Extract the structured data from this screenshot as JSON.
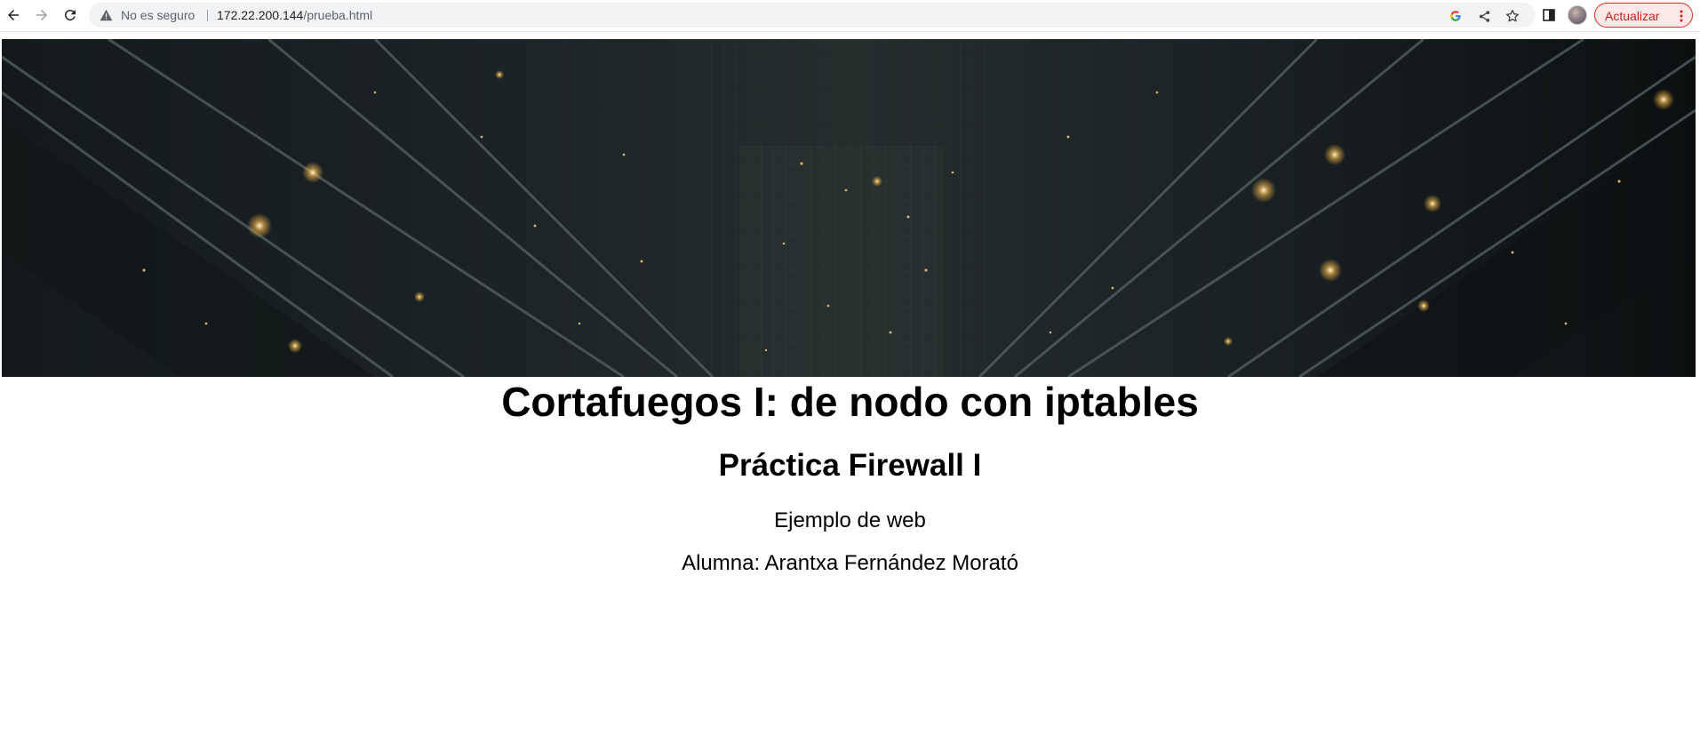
{
  "browser": {
    "security_label": "No es seguro",
    "url_host": "172.22.200.144",
    "url_path": "/prueba.html",
    "update_button_label": "Actualizar",
    "accent_colors": {
      "update": "#d93025",
      "omnibox_bg": "#f1f3f4"
    },
    "icons": [
      "back-arrow-icon",
      "forward-arrow-icon",
      "reload-icon",
      "warning-icon",
      "google-icon",
      "share-icon",
      "star-icon",
      "side-panel-icon",
      "avatar",
      "kebab-menu-icon"
    ]
  },
  "page": {
    "banner_alt": "data-center-corridor-image",
    "title": "Cortafuegos I: de nodo con iptables",
    "subtitle": "Práctica Firewall I",
    "paragraph1": "Ejemplo de web",
    "paragraph2": "Alumna: Arantxa Fernández Morató"
  }
}
